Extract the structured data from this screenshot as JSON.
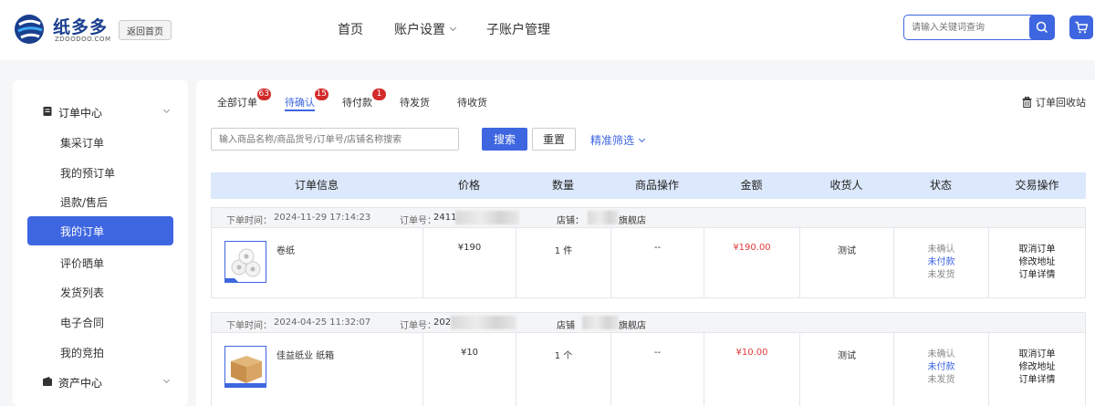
{
  "brand": {
    "name": "纸多多",
    "domain": "ZDOODOO.COM",
    "accent": "#3e66e0"
  },
  "header": {
    "back_home": "返回首页",
    "nav": [
      "首页",
      "账户设置",
      "子账户管理"
    ],
    "search_placeholder": "请输入关键词查询"
  },
  "sidebar": {
    "group_order": "订单中心",
    "group_assets": "资产中心",
    "items": [
      "集采订单",
      "我的预订单",
      "退款/售后",
      "我的订单",
      "评价晒单",
      "发货列表",
      "电子合同",
      "我的竞拍"
    ],
    "active": "我的订单"
  },
  "tabs": [
    {
      "label": "全部订单",
      "badge": "63"
    },
    {
      "label": "待确认",
      "badge": "15"
    },
    {
      "label": "待付款",
      "badge": "1"
    },
    {
      "label": "待发货",
      "badge": ""
    },
    {
      "label": "待收货",
      "badge": ""
    }
  ],
  "recycle_bin": "订单回收站",
  "filter": {
    "placeholder": "输入商品名称/商品货号/订单号/店铺名称搜索",
    "search": "搜索",
    "reset": "重置",
    "advanced": "精准筛选"
  },
  "table": {
    "columns": [
      "订单信息",
      "价格",
      "数量",
      "商品操作",
      "金额",
      "收货人",
      "状态",
      "交易操作"
    ]
  },
  "orders": [
    {
      "time_label": "下单时间：",
      "time": "2024-11-29 17:14:23",
      "no_label": "订单号：",
      "no": "2411",
      "shop_label": "店铺：",
      "shop_suffix": "旗舰店",
      "product": "卷纸",
      "price": "¥190",
      "qty": "1 件",
      "product_op": "--",
      "amount": "¥190.00",
      "receiver": "测试",
      "status": [
        "未确认",
        "未付款",
        "未发货"
      ],
      "actions": [
        "取消订单",
        "修改地址",
        "订单详情"
      ]
    },
    {
      "time_label": "下单时间：",
      "time": "2024-04-25 11:32:07",
      "no_label": "订单号：",
      "no": "202",
      "shop_label": "店铺",
      "shop_suffix": "旗舰店",
      "product": "佳益纸业 纸箱",
      "price": "¥10",
      "qty": "1 个",
      "product_op": "--",
      "amount": "¥10.00",
      "receiver": "测试",
      "status": [
        "未确认",
        "未付款",
        "未发货"
      ],
      "actions": [
        "取消订单",
        "修改地址",
        "订单详情"
      ]
    }
  ]
}
